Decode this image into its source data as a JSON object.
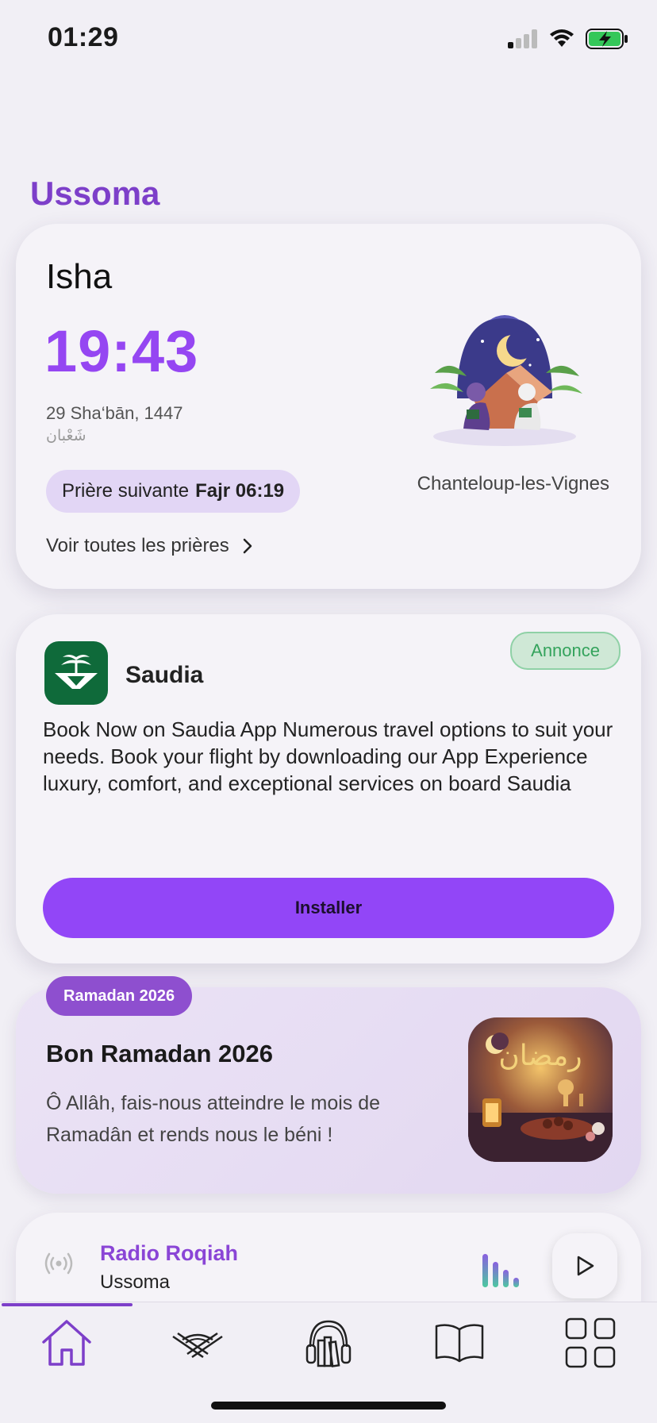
{
  "status_bar": {
    "time": "01:29"
  },
  "app_title": "Ussoma",
  "prayer": {
    "name": "Isha",
    "time": "19:43",
    "hijri_date": "29 Sha‘bān, 1447",
    "hijri_month_arabic": "شَعْبان",
    "next_label": "Prière suivante",
    "next_value": "Fajr 06:19",
    "see_all": "Voir toutes les prières",
    "city": "Chanteloup-les-Vignes"
  },
  "ad": {
    "name": "Saudia",
    "badge": "Annonce",
    "text": "Book Now on Saudia App Numerous travel options to suit your needs. Book your flight by downloading our App Experience luxury, comfort, and exceptional services on board Saudia",
    "button": "Installer",
    "logo_color": "#0f6a3a"
  },
  "ramadan": {
    "tag": "Ramadan 2026",
    "title": "Bon Ramadan 2026",
    "text": "Ô Allâh, fais-nous atteindre le mois de Ramadân et rends nous le béni !",
    "image_text": "رمضان"
  },
  "radio": {
    "name": "Radio Roqiah",
    "subtitle": "Ussoma"
  },
  "tabs": [
    {
      "icon": "home-icon",
      "active": true
    },
    {
      "icon": "quran-stand-icon",
      "active": false
    },
    {
      "icon": "headphones-books-icon",
      "active": false
    },
    {
      "icon": "open-book-icon",
      "active": false
    },
    {
      "icon": "grid-icon",
      "active": false
    }
  ],
  "colors": {
    "accent": "#9546f2",
    "brand": "#7d3fc9",
    "button": "#9246f7",
    "ad_badge": "#34a35c"
  }
}
